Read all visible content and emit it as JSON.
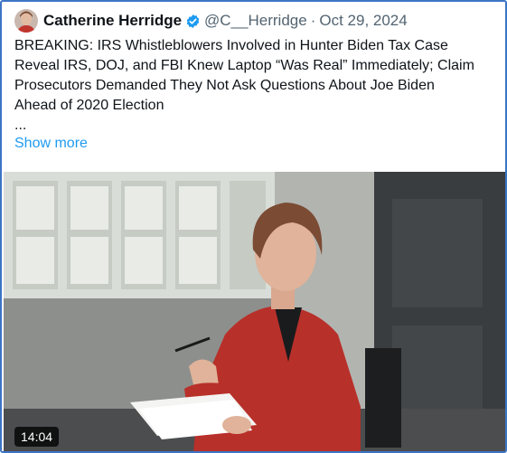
{
  "tweet": {
    "author_name": "Catherine Herridge",
    "handle": "@C__Herridge",
    "separator": "·",
    "date": "Oct 29, 2024",
    "text_lines": [
      "BREAKING: IRS Whistleblowers Involved in Hunter Biden Tax Case",
      "Reveal IRS, DOJ, and FBI Knew Laptop “Was Real” Immediately; Claim",
      "Prosecutors Demanded They Not Ask Questions About Joe Biden",
      "Ahead of 2020 Election",
      "..."
    ],
    "show_more_label": "Show more"
  },
  "video": {
    "duration": "14:04"
  },
  "colors": {
    "frame_border": "#3d74c6",
    "verified_badge": "#1d9bf0",
    "link": "#1d9bf0",
    "jacket": "#b8302a"
  },
  "icons": {
    "verified": "verified-badge-icon",
    "avatar": "author-avatar"
  }
}
